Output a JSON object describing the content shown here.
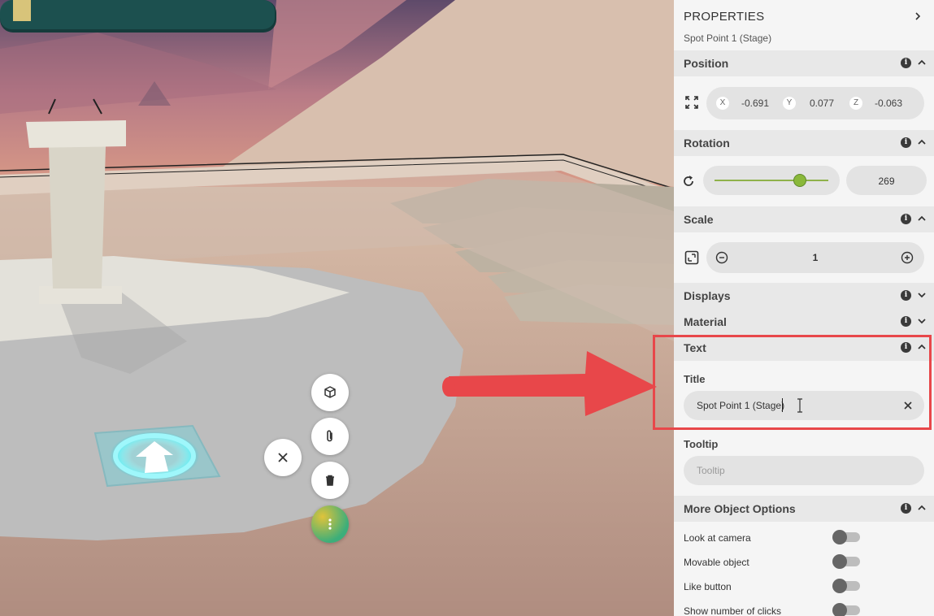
{
  "properties": {
    "header": "PROPERTIES",
    "subtitle": "Spot Point 1 (Stage)",
    "position": {
      "title": "Position",
      "x_label": "X",
      "x_value": "-0.691",
      "y_label": "Y",
      "y_value": "0.077",
      "z_label": "Z",
      "z_value": "-0.063"
    },
    "rotation": {
      "title": "Rotation",
      "value": "269",
      "slider_fraction": 0.75
    },
    "scale": {
      "title": "Scale",
      "value": "1"
    },
    "displays": {
      "title": "Displays"
    },
    "material": {
      "title": "Material"
    },
    "text": {
      "title": "Text",
      "title_label": "Title",
      "title_value": "Spot Point 1 (Stage)",
      "tooltip_label": "Tooltip",
      "tooltip_placeholder": "Tooltip"
    },
    "more_options": {
      "title": "More Object Options",
      "options": [
        "Look at camera",
        "Movable object",
        "Like button",
        "Show number of clicks"
      ]
    }
  },
  "colors": {
    "highlight": "#e8474a",
    "slider_thumb": "#8ab83a",
    "panel_bg": "#f5f5f5",
    "section_bg": "#e8e8e8"
  },
  "icons": [
    "expand-icon",
    "rotate-icon",
    "scale-icon",
    "minus-icon",
    "plus-icon",
    "info-icon",
    "chevron-icon",
    "cube-icon",
    "paperclip-icon",
    "trash-icon",
    "close-icon",
    "more-icon"
  ]
}
